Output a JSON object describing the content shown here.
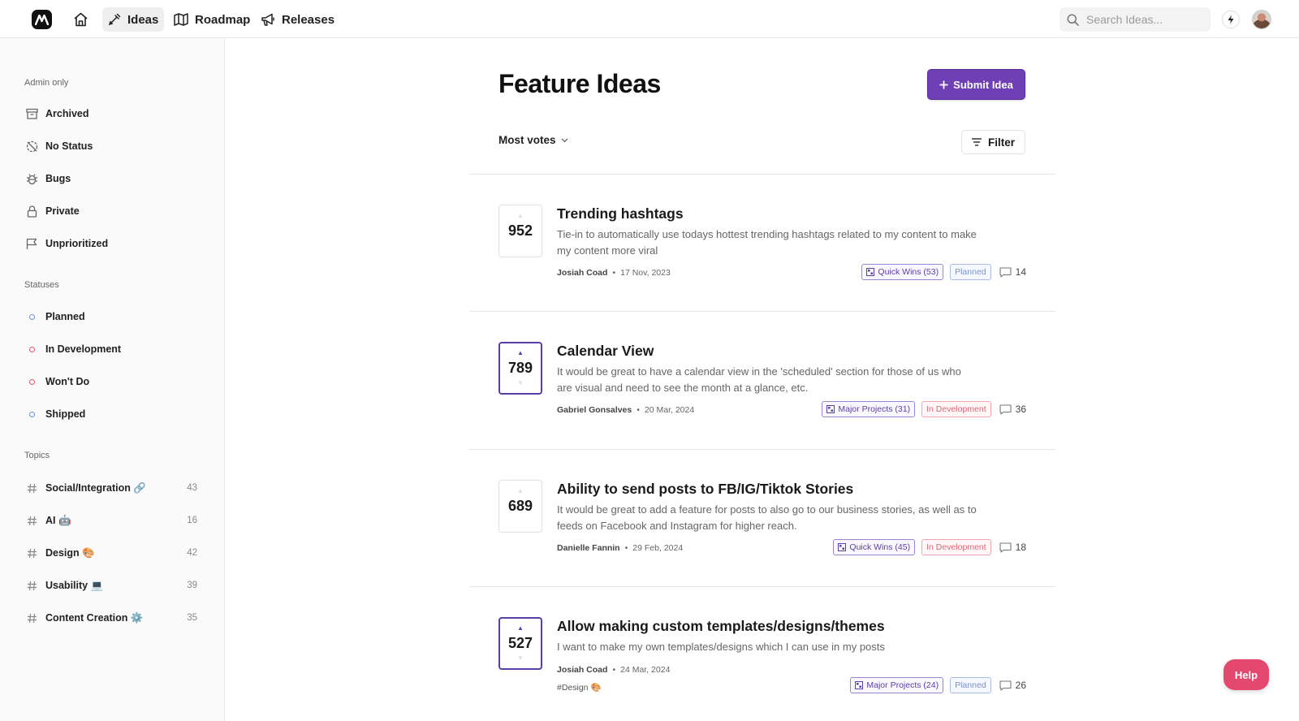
{
  "nav": {
    "ideas": "Ideas",
    "roadmap": "Roadmap",
    "releases": "Releases"
  },
  "search": {
    "placeholder": "Search Ideas..."
  },
  "sidebar": {
    "admin_title": "Admin only",
    "admin_items": [
      "Archived",
      "No Status",
      "Bugs",
      "Private",
      "Unprioritized"
    ],
    "statuses_title": "Statuses",
    "statuses": [
      {
        "label": "Planned",
        "color": "#6f8fd6"
      },
      {
        "label": "In Development",
        "color": "#e0566a"
      },
      {
        "label": "Won't Do",
        "color": "#e0566a"
      },
      {
        "label": "Shipped",
        "color": "#6f8fd6"
      }
    ],
    "topics_title": "Topics",
    "topics": [
      {
        "label": "Social/Integration 🔗",
        "count": "43"
      },
      {
        "label": "AI 🤖",
        "count": "16"
      },
      {
        "label": "Design 🎨",
        "count": "42"
      },
      {
        "label": "Usability 💻",
        "count": "39"
      },
      {
        "label": "Content Creation ⚙️",
        "count": "35"
      }
    ]
  },
  "main": {
    "title": "Feature Ideas",
    "submit_label": "Submit Idea",
    "sort_label": "Most votes",
    "filter_label": "Filter",
    "ideas": [
      {
        "votes": "952",
        "title": "Trending hashtags",
        "description": "Tie-in to automatically use todays hottest trending hashtags related to my content to make my content more viral",
        "author": "Josiah Coad",
        "date": "17 Nov, 2023",
        "project": "Quick Wins (53)",
        "status": "Planned",
        "comments": "14"
      },
      {
        "votes": "789",
        "title": "Calendar View",
        "description": "It would be great to have a calendar view in the 'scheduled' section for those of us who are visual and need to see the month at a glance, etc.",
        "author": "Gabriel Gonsalves",
        "date": "20 Mar, 2024",
        "project": "Major Projects (31)",
        "status": "In Development",
        "comments": "36"
      },
      {
        "votes": "689",
        "title": "Ability to send posts to FB/IG/Tiktok Stories",
        "description": "It would be great to add a feature for posts to also go to our business stories, as well as to feeds on Facebook and Instagram for higher reach.",
        "author": "Danielle Fannin",
        "date": "29 Feb, 2024",
        "project": "Quick Wins (45)",
        "status": "In Development",
        "comments": "18"
      },
      {
        "votes": "527",
        "title": "Allow making custom templates/designs/themes",
        "description": "I want to make my own templates/designs which I can use in my posts",
        "author": "Josiah Coad",
        "date": "24 Mar, 2024",
        "topic": "#Design 🎨",
        "project": "Major Projects (24)",
        "status": "Planned",
        "comments": "26"
      }
    ]
  },
  "help_label": "Help",
  "colors": {
    "accent": "#6f3fb5",
    "help": "#e5486f"
  }
}
